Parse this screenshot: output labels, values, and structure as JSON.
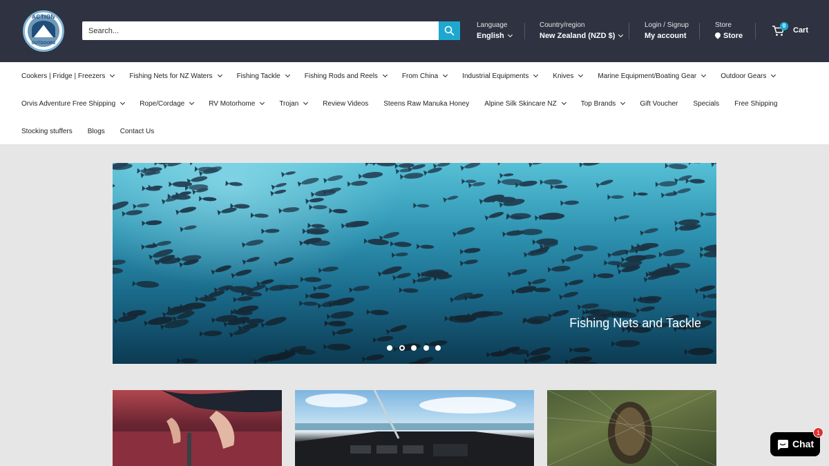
{
  "header": {
    "logo": {
      "top_text": "ACTION",
      "bottom_text": "OUTDOORS"
    },
    "search": {
      "placeholder": "Search..."
    },
    "language": {
      "label": "Language",
      "value": "English"
    },
    "country": {
      "label": "Country/region",
      "value": "New Zealand (NZD $)"
    },
    "account": {
      "label": "Login / Signup",
      "value": "My account"
    },
    "store": {
      "label": "Store",
      "value": "Store"
    },
    "cart": {
      "count": "0",
      "label": "Cart"
    }
  },
  "nav": {
    "rows": [
      [
        {
          "label": "Cookers | Fridge | Freezers",
          "dropdown": true
        },
        {
          "label": "Fishing Nets for NZ Waters",
          "dropdown": true
        },
        {
          "label": "Fishing Tackle",
          "dropdown": true
        },
        {
          "label": "Fishing Rods and Reels",
          "dropdown": true
        },
        {
          "label": "From China",
          "dropdown": true
        },
        {
          "label": "Industrial Equipments",
          "dropdown": true
        },
        {
          "label": "Knives",
          "dropdown": true
        },
        {
          "label": "Marine Equipment/Boating Gear",
          "dropdown": true
        },
        {
          "label": "Outdoor Gears",
          "dropdown": true
        }
      ],
      [
        {
          "label": "Orvis Adventure Free Shipping",
          "dropdown": true
        },
        {
          "label": "Rope/Cordage",
          "dropdown": true
        },
        {
          "label": "RV Motorhome",
          "dropdown": true
        },
        {
          "label": "Trojan",
          "dropdown": true
        },
        {
          "label": "Review Videos",
          "dropdown": false
        },
        {
          "label": "Steens Raw Manuka Honey",
          "dropdown": false
        },
        {
          "label": "Alpine Silk Skincare NZ",
          "dropdown": true
        },
        {
          "label": "Top Brands",
          "dropdown": true
        },
        {
          "label": "Gift Voucher",
          "dropdown": false
        },
        {
          "label": "Specials",
          "dropdown": false
        },
        {
          "label": "Free Shipping",
          "dropdown": false
        }
      ],
      [
        {
          "label": "Stocking stuffers",
          "dropdown": false
        },
        {
          "label": "Blogs",
          "dropdown": false
        },
        {
          "label": "Contact Us",
          "dropdown": false
        }
      ]
    ]
  },
  "hero": {
    "title": "Fishing Nets and Tackle",
    "slide_count": 5,
    "active_slide": 2
  },
  "chat": {
    "label": "Chat",
    "badge": "1"
  },
  "colors": {
    "header_bg": "#2e3241",
    "accent": "#1fa8cf",
    "badge_red": "#e0312f"
  }
}
